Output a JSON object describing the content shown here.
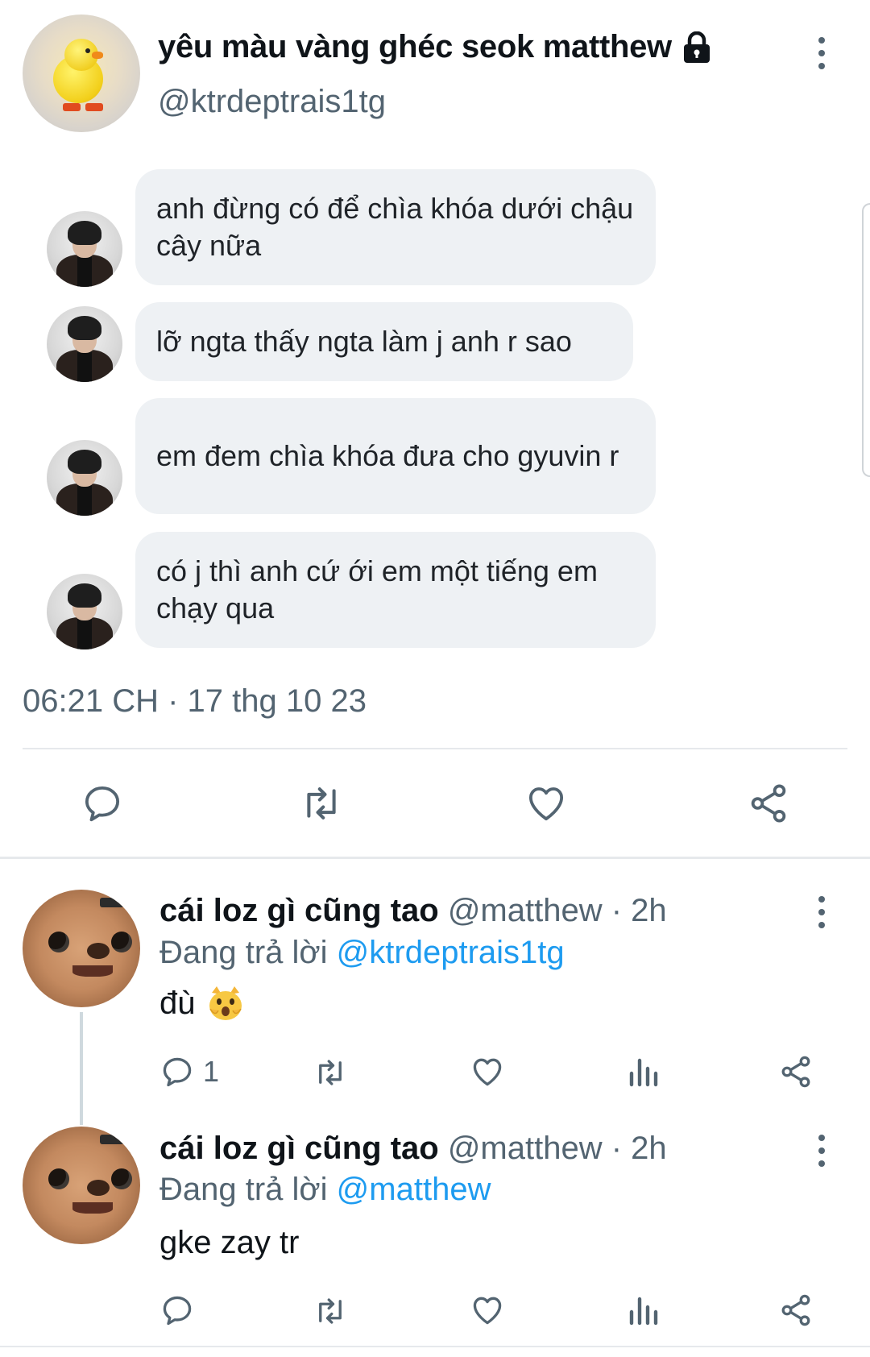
{
  "main_tweet": {
    "display_name": "yêu màu vàng ghéc seok matthew",
    "handle": "@ktrdeptrais1tg",
    "avatar_icon": "yellow-chick-avatar",
    "locked_icon": "lock-icon",
    "messages": [
      {
        "text": "anh đừng có để chìa khóa dưới chậu cây nữa"
      },
      {
        "text": "lỡ ngta thấy ngta làm j anh r sao"
      },
      {
        "text": "em đem chìa khóa đưa cho gyuvin r"
      },
      {
        "text": "có j thì anh cứ ới em một tiếng em chạy qua"
      }
    ],
    "timestamp": "06:21 CH · 17 thg 10 23"
  },
  "replies": [
    {
      "display_name": "cái loz gì cũng tao",
      "handle": "@matthew",
      "time": "· 2h",
      "replying_label": "Đang trả lời",
      "replying_to": "@ktrdeptrais1tg",
      "text": "đù",
      "emoji": "😿",
      "reply_count": "1"
    },
    {
      "display_name": "cái loz gì cũng tao",
      "handle": "@matthew",
      "time": "· 2h",
      "replying_label": "Đang trả lời",
      "replying_to": "@matthew",
      "text": "gke zay tr",
      "reply_count": ""
    }
  ],
  "colors": {
    "text_primary": "#0f1419",
    "text_secondary": "#536471",
    "link": "#1d9bf0",
    "bubble_bg": "#eef1f4",
    "divider": "#e6e9ec"
  }
}
